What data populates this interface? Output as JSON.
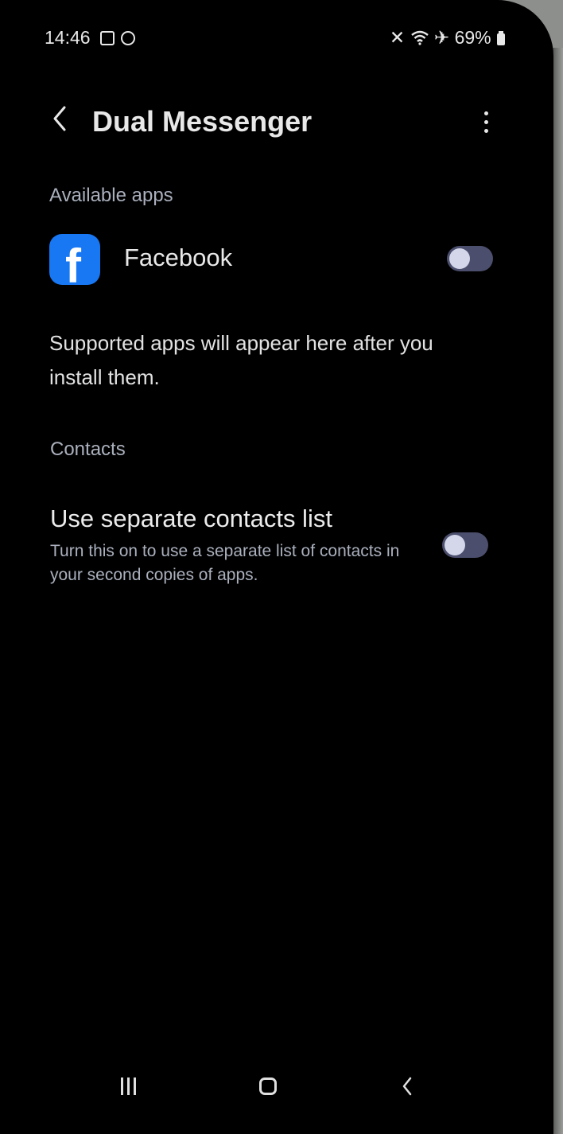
{
  "status_bar": {
    "time": "14:46",
    "icons_left": [
      "checkbox-icon",
      "circle-icon"
    ],
    "icons_right": [
      "mute-icon",
      "wifi-icon",
      "airplane-icon",
      "battery-icon"
    ],
    "battery": "69%"
  },
  "header": {
    "title": "Dual Messenger",
    "back_icon": "chevron-left-icon",
    "more_icon": "more-vertical-icon"
  },
  "available_apps": {
    "section_label": "Available apps",
    "items": [
      {
        "label": "Facebook",
        "icon": "facebook-icon",
        "toggle_on": false
      }
    ],
    "note": "Supported apps will appear here after you install them."
  },
  "contacts": {
    "section_label": "Contacts",
    "title": "Use separate contacts list",
    "subtitle": "Turn this on to use a separate list of contacts in your second copies of apps.",
    "toggle_on": false
  },
  "nav_bar": {
    "recents_icon": "recents-icon",
    "home_icon": "home-icon",
    "back_icon": "back-icon"
  },
  "colors": {
    "background": "#000000",
    "text_primary": "#e8e8e8",
    "text_secondary": "#aab0bd",
    "toggle_track_off": "#4b4e6c",
    "toggle_knob": "#d4d6ea",
    "facebook_blue": "#1877f2"
  }
}
